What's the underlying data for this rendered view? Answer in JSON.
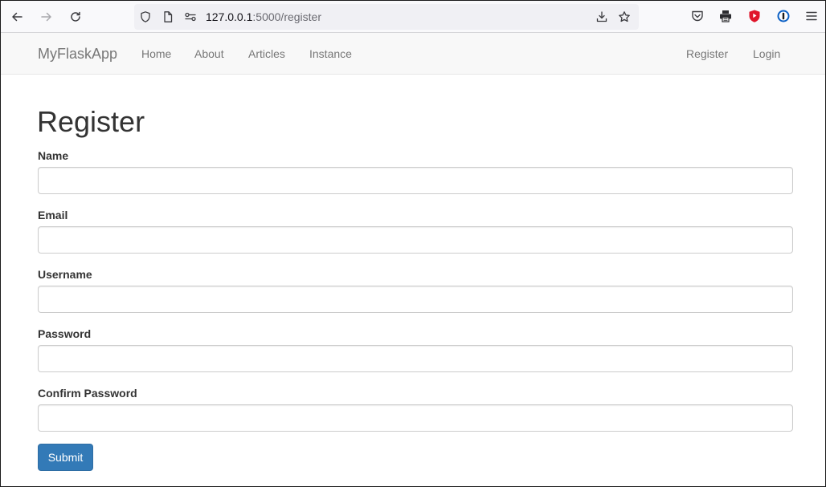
{
  "browser": {
    "url_host": "127.0.0.1",
    "url_path": ":5000/register",
    "icons": [
      "back-arrow-icon",
      "forward-arrow-icon",
      "reload-icon",
      "shield-icon",
      "page-icon",
      "permissions-icon",
      "download-icon",
      "bookmark-star-icon",
      "pocket-icon",
      "printer-icon",
      "extension-play-icon",
      "password-manager-icon",
      "hamburger-menu-icon"
    ]
  },
  "navbar": {
    "brand": "MyFlaskApp",
    "left_links": [
      "Home",
      "About",
      "Articles",
      "Instance"
    ],
    "right_links": [
      "Register",
      "Login"
    ]
  },
  "form": {
    "title": "Register",
    "fields": [
      {
        "label": "Name",
        "value": ""
      },
      {
        "label": "Email",
        "value": ""
      },
      {
        "label": "Username",
        "value": ""
      },
      {
        "label": "Password",
        "value": ""
      },
      {
        "label": "Confirm Password",
        "value": ""
      }
    ],
    "submit_label": "Submit"
  },
  "colors": {
    "primary_button": "#337ab7",
    "navbar_bg": "#f8f8f8",
    "nav_text": "#777777",
    "heading_text": "#333333",
    "extension_red": "#e0152b",
    "password_manager_blue": "#0a5fc4"
  }
}
